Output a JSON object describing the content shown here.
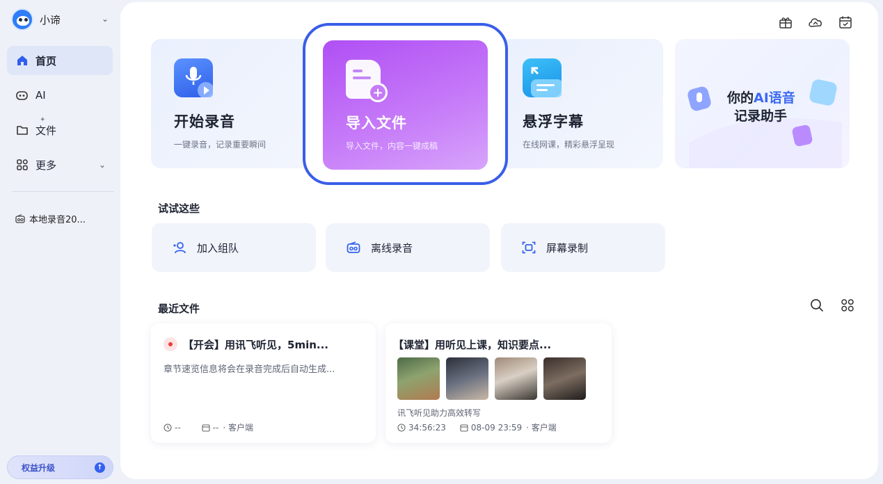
{
  "user": {
    "name": "小谛"
  },
  "nav": {
    "home": "首页",
    "ai": "AI",
    "files": "文件",
    "more": "更多"
  },
  "local_recording": "本地录音20...",
  "upgrade": "权益升级",
  "cards": {
    "record": {
      "title": "开始录音",
      "subtitle": "一键录音，记录重要瞬间"
    },
    "import": {
      "title": "导入文件",
      "subtitle": "导入文件，内容一键成稿"
    },
    "floating": {
      "title": "悬浮字幕",
      "subtitle": "在线网课，精彩悬浮呈现"
    },
    "promo": {
      "line1_prefix": "你的",
      "line1_accent": "AI语音",
      "line2": "记录助手"
    }
  },
  "try_section": {
    "title": "试试这些",
    "items": [
      "加入组队",
      "离线录音",
      "屏幕录制"
    ]
  },
  "recent": {
    "title": "最近文件",
    "files": [
      {
        "title": "【开会】用讯飞听见，5min...",
        "desc": "章节速览信息将会在录音完成后自动生成...",
        "duration": "--",
        "date": "--",
        "source": "· 客户端"
      },
      {
        "title": "【课堂】用听见上课，知识要点...",
        "desc": "讯飞听见助力高效转写",
        "duration": "34:56:23",
        "date": "08-09 23:59",
        "source": "· 客户端"
      }
    ]
  },
  "colors": {
    "accent": "#3a5ee8",
    "import_card": "#b04ff5",
    "record_dot": "#ef3b3b"
  },
  "icons": [
    "home-icon",
    "ai-icon",
    "file-icon",
    "grid-icon",
    "gift-icon",
    "cloud-icon",
    "calendar-icon",
    "mic-icon",
    "subtitle-icon",
    "team-icon",
    "radio-icon",
    "screen-record-icon",
    "search-icon",
    "grid-view-icon",
    "clock-icon",
    "calendar-small-icon"
  ]
}
